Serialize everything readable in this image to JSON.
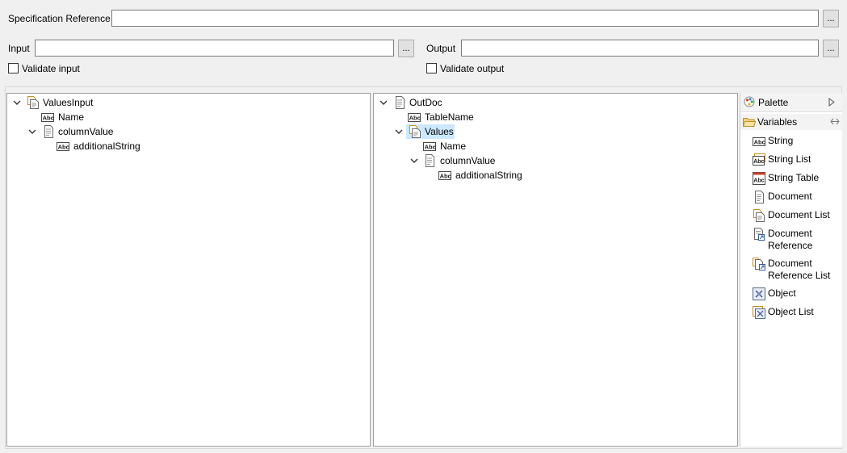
{
  "spec": {
    "label": "Specification Reference",
    "value": "",
    "browse": "..."
  },
  "input": {
    "label": "Input",
    "value": "",
    "browse": "...",
    "validate_label": "Validate input"
  },
  "output": {
    "label": "Output",
    "value": "",
    "browse": "...",
    "validate_label": "Validate output"
  },
  "left_tree": {
    "root": "ValuesInput",
    "name": "Name",
    "column": "columnValue",
    "additional": "additionalString"
  },
  "right_tree": {
    "root": "OutDoc",
    "table": "TableName",
    "values": "Values",
    "name": "Name",
    "column": "columnValue",
    "additional": "additionalString"
  },
  "palette": {
    "title": "Palette",
    "section": "Variables",
    "items": [
      {
        "label": "String",
        "icon": "string-icon"
      },
      {
        "label": "String List",
        "icon": "string-list-icon"
      },
      {
        "label": "String Table",
        "icon": "string-table-icon"
      },
      {
        "label": "Document",
        "icon": "document-icon"
      },
      {
        "label": "Document List",
        "icon": "document-list-icon"
      },
      {
        "label_line1": "Document",
        "label_line2": "Reference",
        "icon": "document-reference-icon"
      },
      {
        "label_line1": "Document",
        "label_line2": "Reference List",
        "icon": "document-reference-list-icon"
      },
      {
        "label": "Object",
        "icon": "object-icon"
      },
      {
        "label": "Object List",
        "icon": "object-list-icon"
      }
    ]
  }
}
